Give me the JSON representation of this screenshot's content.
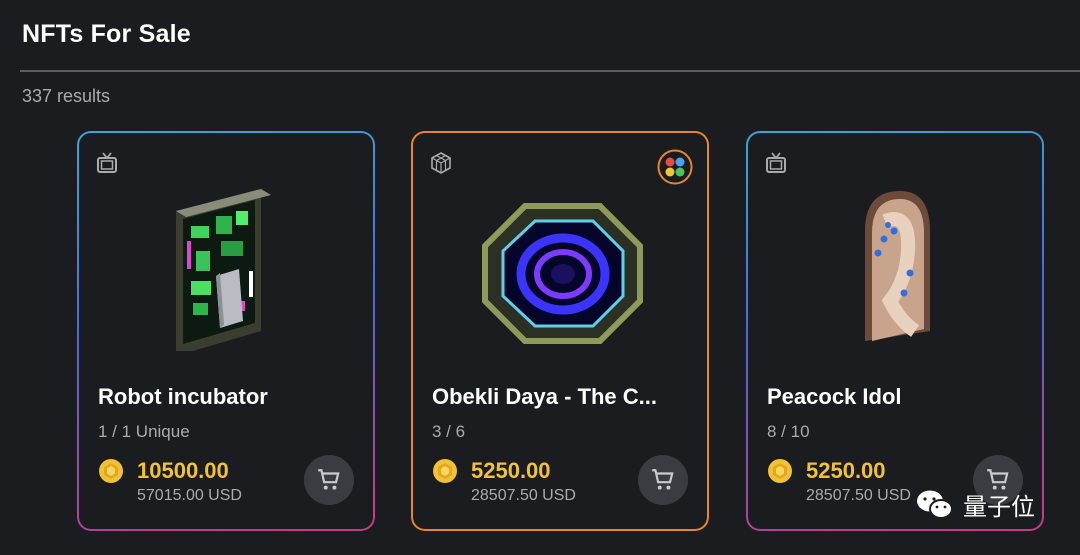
{
  "page": {
    "title": "NFTs For Sale",
    "results": "337 results"
  },
  "cards": [
    {
      "name": "Robot incubator",
      "edition": "1 / 1 Unique",
      "price": "10500.00",
      "usd": "57015.00 USD",
      "type_icon": "tv-icon",
      "border": "gradient blue-purple-pink"
    },
    {
      "name": "Obekli Daya - The C...",
      "edition": "3 / 6",
      "price": "5250.00",
      "usd": "28507.50 USD",
      "type_icon": "cube-icon",
      "badge_icon": "colored-dots-badge-icon",
      "border": "#e6862f"
    },
    {
      "name": "Peacock Idol",
      "edition": "8 / 10",
      "price": "5250.00",
      "usd": "28507.50 USD",
      "type_icon": "tv-icon",
      "border": "gradient blue-purple-pink"
    }
  ],
  "watermark": {
    "text": "量子位"
  },
  "colors": {
    "background": "#1b1c1f",
    "price": "#f2c236",
    "cart_button": "#3a3c41",
    "muted_text": "#a9abb0"
  }
}
